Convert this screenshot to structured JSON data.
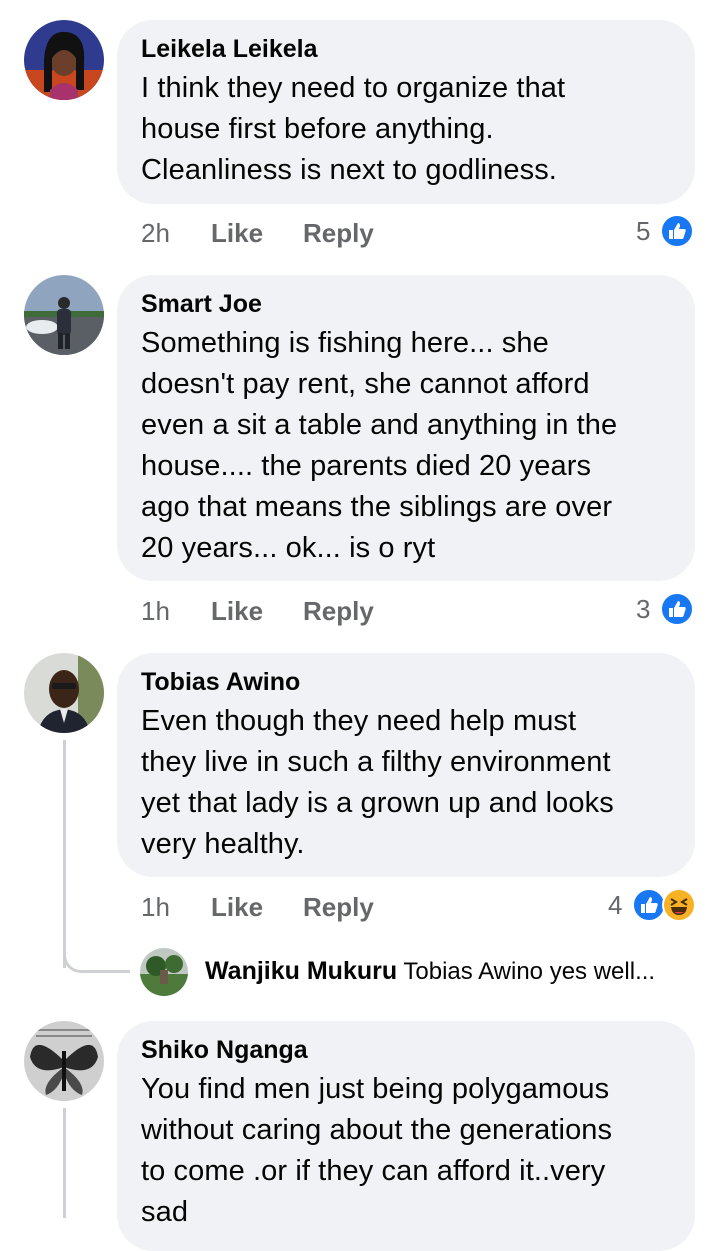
{
  "comments": [
    {
      "name": "Leikela Leikela",
      "lines": [
        "I think they need to organize that",
        "house first before anything.",
        "Cleanliness is next to godliness."
      ],
      "time": "2h",
      "like_label": "Like",
      "reply_label": "Reply",
      "reaction_count": "5",
      "reactions": [
        "like-icon"
      ]
    },
    {
      "name": "Smart Joe",
      "lines": [
        "Something is fishing here... she",
        "doesn't pay rent, she cannot afford",
        "even a sit a table and anything in the",
        "house.... the parents died 20 years",
        "ago that means the siblings are over",
        "20 years... ok... is o ryt"
      ],
      "time": "1h",
      "like_label": "Like",
      "reply_label": "Reply",
      "reaction_count": "3",
      "reactions": [
        "like-icon"
      ]
    },
    {
      "name": "Tobias Awino",
      "lines": [
        "Even though they need help must",
        "they live in such a filthy environment",
        "yet that lady is a grown up and looks",
        "very healthy."
      ],
      "time": "1h",
      "like_label": "Like",
      "reply_label": "Reply",
      "reaction_count": "4",
      "reactions": [
        "like-icon",
        "haha-icon"
      ],
      "reply": {
        "name": "Wanjiku Mukuru",
        "mention": "Tobias Awino",
        "text": "yes well..."
      }
    },
    {
      "name": "Shiko Nganga",
      "lines": [
        "You find men just being polygamous",
        "without caring about the generations",
        "to come .or if they can afford it..very",
        "sad"
      ]
    }
  ],
  "colors": {
    "bubble": "#f0f2f5",
    "secondary_text": "#65676b",
    "like_blue": "#1877f2",
    "haha_yellow": "#f7b125"
  }
}
